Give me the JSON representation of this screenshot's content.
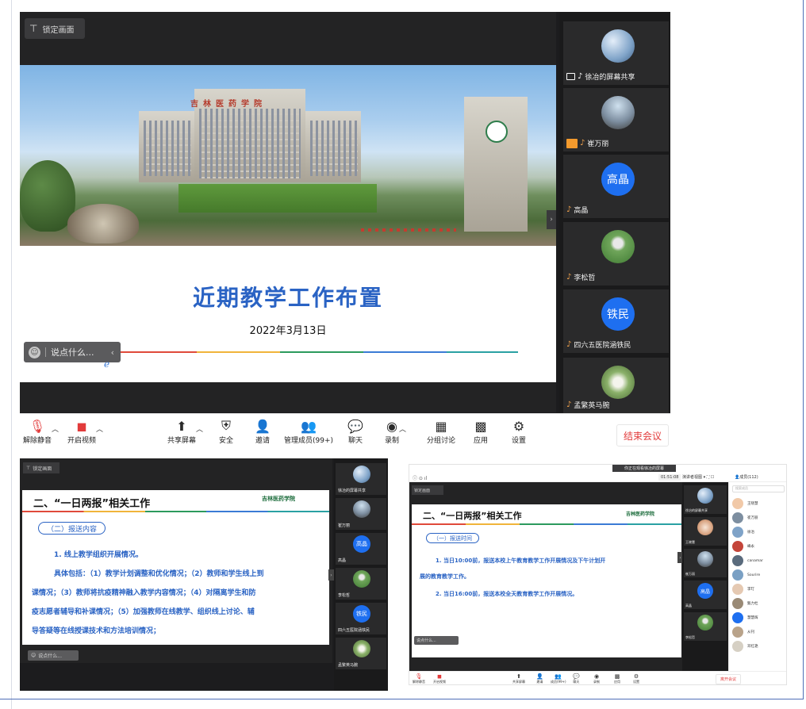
{
  "main": {
    "lock_screen": "锁定画面",
    "slide": {
      "building_sign": "吉林医药学院",
      "title": "近期教学工作布置",
      "date": "2022年3月13日"
    },
    "chat_placeholder": "说点什么...",
    "participants": [
      {
        "name": "徐冶的屏幕共享",
        "kind": "share"
      },
      {
        "name": "崔万丽",
        "kind": "photo"
      },
      {
        "name": "高晶",
        "initials": "高晶",
        "kind": "initials"
      },
      {
        "name": "李松哲",
        "kind": "photo"
      },
      {
        "name": "四六五医院涵铁民",
        "initials": "铁民",
        "kind": "initials"
      },
      {
        "name": "孟繁英马腕",
        "kind": "photo"
      }
    ],
    "toolbar": {
      "unmute": "解除静音",
      "start_video": "开启视频",
      "share_screen": "共享屏幕",
      "security": "安全",
      "invite": "邀请",
      "manage_members": "管理成员(99+)",
      "chat": "聊天",
      "record": "录制",
      "breakout": "分组讨论",
      "apps": "应用",
      "settings": "设置",
      "end_meeting": "结束会议"
    }
  },
  "shot2": {
    "lock_screen": "锁定画面",
    "heading": "二、“一日两报”相关工作",
    "logo_text": "吉林医药学院",
    "box_label": "（二）报送内容",
    "lines": [
      "1. 线上教学组织开展情况。",
      "具体包括：（1）教学计划调整和优化情况；（2）教师和学生线上到",
      "课情况；（3）教师将抗疫精神融入教学内容情况；（4）对隔离学生和防",
      "疫志愿者辅导和补课情况；（5）加强教师在线教学、组织线上讨论、辅",
      "导答疑等在线授课技术和方法培训情况；"
    ],
    "chat_placeholder": "说点什么...",
    "participants": [
      "徐冶的屏幕共享",
      "崔万丽",
      "高晶",
      "李松哲",
      "四六五医院涵铁民",
      "孟繁英马腕"
    ]
  },
  "shot3": {
    "banner": "你正在观看徐冶的屏幕",
    "timer": "01:51:08",
    "view_label": "演讲者视图",
    "members_label": "成员(112)",
    "lock_screen": "锁定画面",
    "heading": "二、“一日两报”相关工作",
    "logo_text": "吉林医药学院",
    "box_label": "（一）报送时间",
    "lines": [
      "1. 当日10:00前，报送本校上午教育教学工作开展情况及下午计划开",
      "展的教育教学工作。",
      "2. 当日16:00前，报送本校全天教育教学工作开展情况。"
    ],
    "chat_placeholder": "说点什么...",
    "search_placeholder": "搜索成员",
    "members": [
      "王晓慧",
      "崔万丽",
      "徐冶",
      "峰永",
      "canamar",
      "Sourire",
      "李玎",
      "甄力杜",
      "慧慧辉",
      "从刊",
      "邓红艳"
    ],
    "tiles": [
      "徐冶的屏幕共享",
      "王晓慧",
      "崔万丽",
      "高晶",
      "李松哲"
    ],
    "toolbar": {
      "unmute": "解除静音",
      "start_video": "开启视频",
      "share_screen": "共享屏幕",
      "invite": "邀请",
      "members": "成员(99+)",
      "chat": "聊天",
      "record": "录制",
      "apps": "应用",
      "settings": "设置",
      "end_meeting": "离开会议"
    }
  }
}
